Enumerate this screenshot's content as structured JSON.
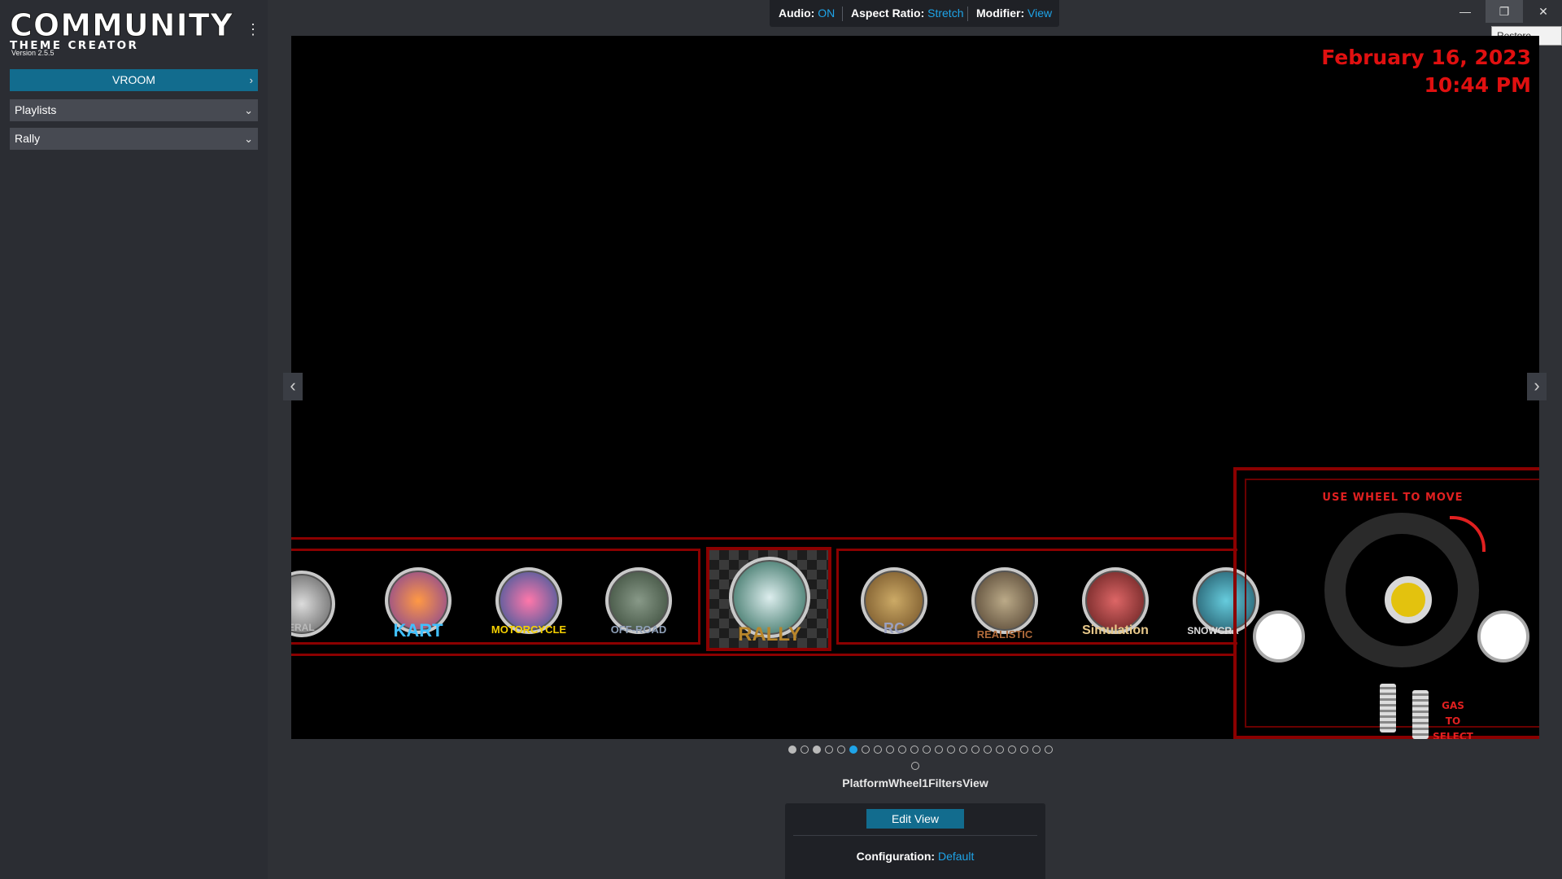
{
  "app": {
    "logo_line1": "COMMUNITY",
    "logo_line2": "THEME CREATOR",
    "version": "Version 2.5.5"
  },
  "sidebar": {
    "primary_label": "VROOM",
    "select1": "Playlists",
    "select2": "Rally"
  },
  "topbar": {
    "audio_label": "Audio:",
    "audio_value": "ON",
    "aspect_label": "Aspect Ratio:",
    "aspect_value": "Stretch",
    "modifier_label": "Modifier:",
    "modifier_value": "View"
  },
  "window": {
    "restore_tooltip": "Restore Down"
  },
  "preview": {
    "date": "February 16, 2023",
    "time": "10:44 PM",
    "wheel_labels": [
      "NERAL",
      "KART",
      "MOTORCYCLE",
      "OFF-ROAD",
      "RALLY",
      "RC",
      "REALISTIC",
      "Simulation",
      "SNOWCRA"
    ],
    "panel_title": "USE WHEEL TO MOVE",
    "gas_text": [
      "GAS",
      "TO",
      "SELECT"
    ]
  },
  "pager": {
    "total": 22,
    "active_index": 5,
    "filled": [
      0,
      2
    ],
    "extra_dot": true
  },
  "view_name": "PlatformWheel1FiltersView",
  "bottom": {
    "edit_label": "Edit View",
    "config_label": "Configuration:",
    "config_value": "Default"
  },
  "colors": {
    "accent": "#126c8e",
    "link": "#1fa4e8",
    "red": "#e01010",
    "dark_red": "#8b0000"
  }
}
